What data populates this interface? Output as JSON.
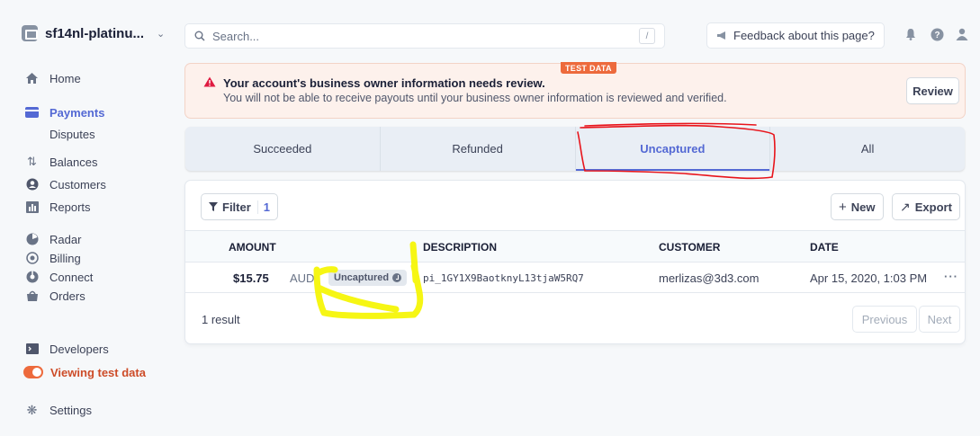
{
  "sidebar": {
    "account_name": "sf14nl-platinu...",
    "items": [
      {
        "label": "Home",
        "icon": "home-icon"
      },
      {
        "label": "Payments",
        "icon": "payments-icon"
      },
      {
        "label": "Disputes"
      },
      {
        "label": "Balances",
        "icon": "balances-icon"
      },
      {
        "label": "Customers",
        "icon": "customers-icon"
      },
      {
        "label": "Reports",
        "icon": "reports-icon"
      },
      {
        "label": "Radar",
        "icon": "radar-icon"
      },
      {
        "label": "Billing",
        "icon": "billing-icon"
      },
      {
        "label": "Connect",
        "icon": "connect-icon"
      },
      {
        "label": "Orders",
        "icon": "orders-icon"
      },
      {
        "label": "Developers",
        "icon": "developers-icon"
      },
      {
        "label": "Viewing test data",
        "icon": "toggle-icon"
      },
      {
        "label": "Settings",
        "icon": "gear-icon"
      }
    ]
  },
  "topbar": {
    "search_placeholder": "Search...",
    "search_shortcut": "/",
    "feedback_label": "Feedback about this page?"
  },
  "banner": {
    "badge": "TEST DATA",
    "title": "Your account's business owner information needs review.",
    "text": "You will not be able to receive payouts until your business owner information is reviewed and verified.",
    "button": "Review"
  },
  "tabs": [
    {
      "label": "Succeeded"
    },
    {
      "label": "Refunded"
    },
    {
      "label": "Uncaptured",
      "active": true
    },
    {
      "label": "All"
    }
  ],
  "table": {
    "filter_label": "Filter",
    "filter_count": "1",
    "new_label": "New",
    "export_label": "Export",
    "columns": [
      "AMOUNT",
      "DESCRIPTION",
      "CUSTOMER",
      "DATE"
    ],
    "rows": [
      {
        "amount": "$15.75",
        "currency": "AUD",
        "status": "Uncaptured",
        "description": "pi_1GY1X9BaotknyL13tjaW5RQ7",
        "customer": "merlizas@3d3.com",
        "date": "Apr 15, 2020, 1:03 PM"
      }
    ],
    "result_count": "1 result",
    "previous_label": "Previous",
    "next_label": "Next"
  },
  "colors": {
    "accent": "#5469d4",
    "test_orange": "#ed6a3c",
    "red_annotation": "#e8141b",
    "yellow_annotation": "#f5f500"
  }
}
